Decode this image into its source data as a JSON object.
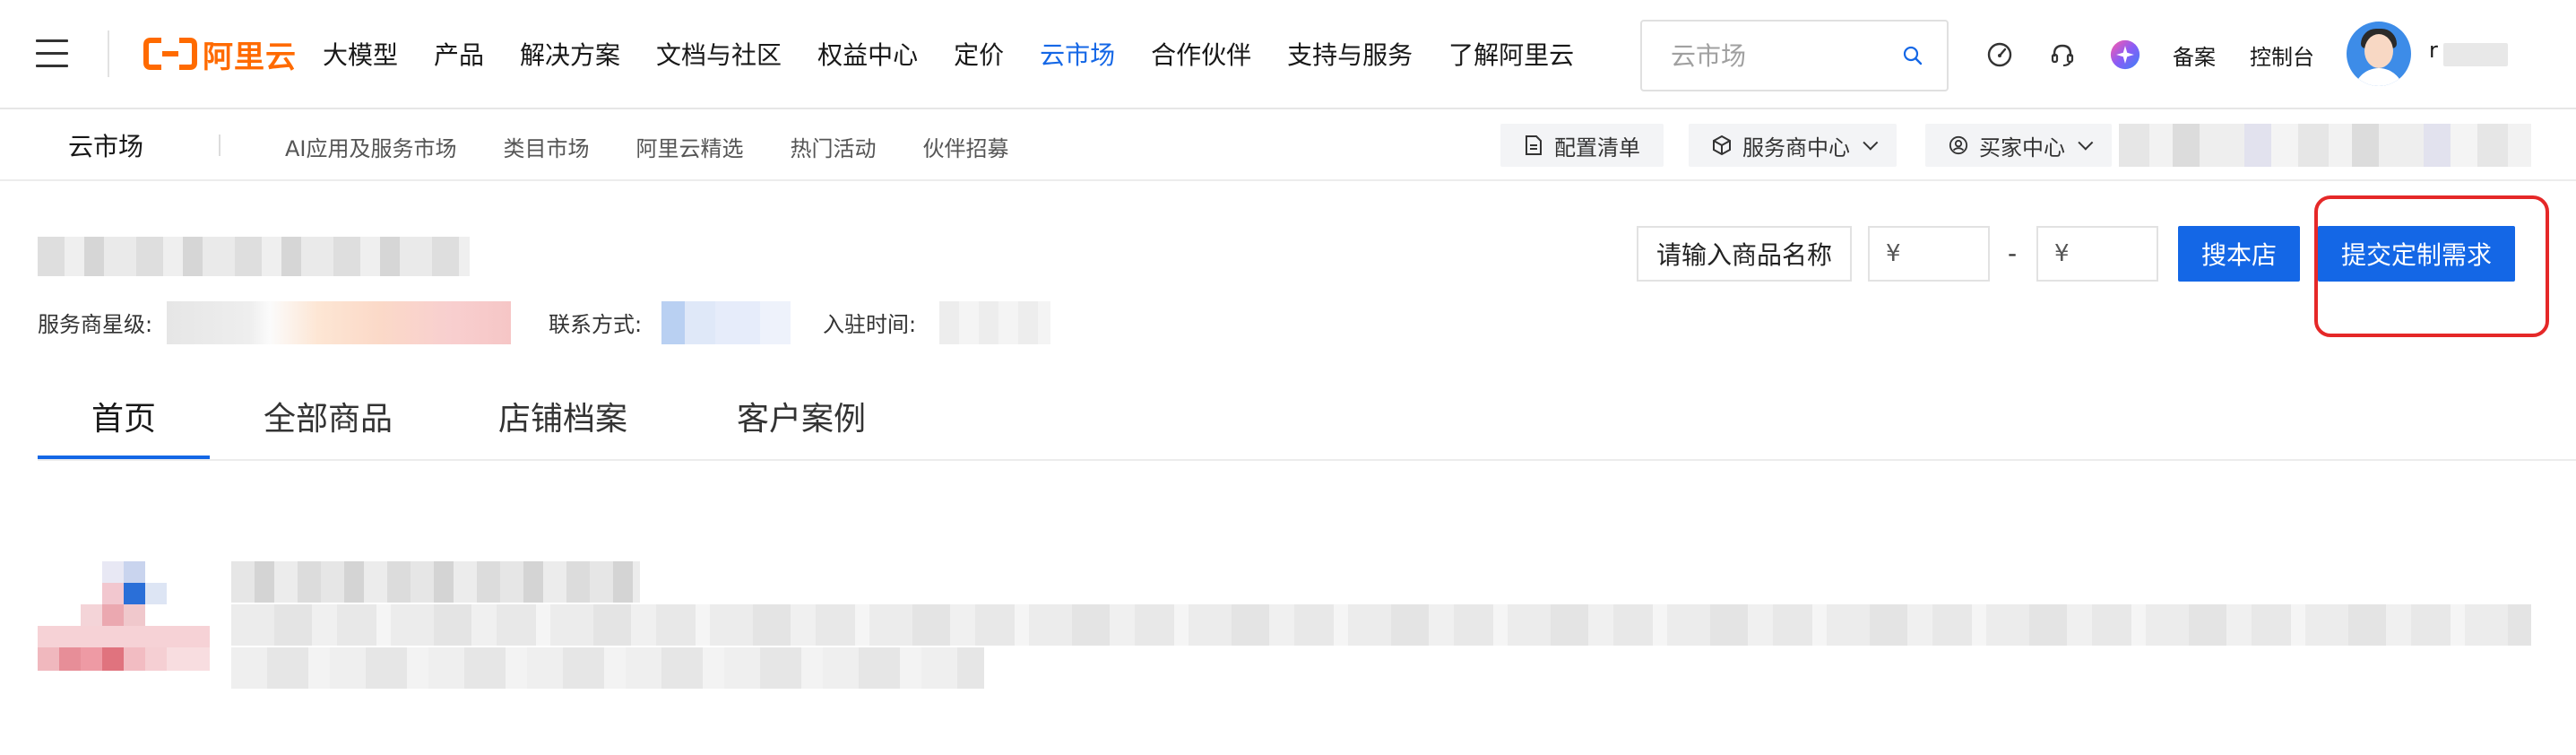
{
  "brand": {
    "logo_text": "阿里云",
    "logo_color": "#ff6a00"
  },
  "topnav": {
    "links": [
      "大模型",
      "产品",
      "解决方案",
      "文档与社区",
      "权益中心",
      "定价",
      "云市场",
      "合作伙伴",
      "支持与服务",
      "了解阿里云"
    ],
    "active_link": "云市场",
    "search_placeholder": "云市场",
    "record_label": "备案",
    "console_label": "控制台",
    "username": "r",
    "accent_color": "#1467e6"
  },
  "subnav": {
    "title": "云市场",
    "links": [
      "AI应用及服务市场",
      "类目市场",
      "阿里云精选",
      "热门活动",
      "伙伴招募"
    ],
    "config_list": "配置清单",
    "provider_center": "服务商中心",
    "buyer_center": "买家中心"
  },
  "shop": {
    "star_label": "服务商星级:",
    "contact_label": "联系方式:",
    "joined_label": "入驻时间:",
    "product_name_prompt": "请输入商品名称",
    "price_min_symbol": "¥",
    "price_max_symbol": "¥",
    "price_separator": "-",
    "search_shop_button": "搜本店",
    "submit_custom_button": "提交定制需求"
  },
  "tabs": {
    "items": [
      "首页",
      "全部商品",
      "店铺档案",
      "客户案例"
    ],
    "active": "首页"
  }
}
